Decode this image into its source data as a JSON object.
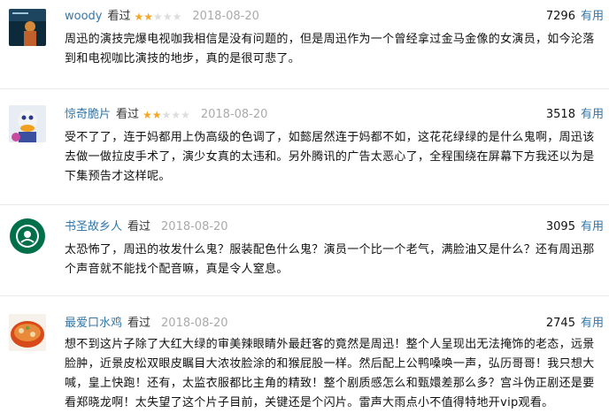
{
  "comments": [
    {
      "user": "woody",
      "status": "看过",
      "rating_stars": 2,
      "date": "2018-08-20",
      "votes": "7296",
      "useful_label": "有用",
      "text": "周迅的演技完爆电视咖我相信是没有问题的，但是周迅作为一个曾经拿过金马金像的女演员，如今沦落到和电视咖比演技的地步，真的是很可悲了。"
    },
    {
      "user": "惊奇脆片",
      "status": "看过",
      "rating_stars": 2,
      "date": "2018-08-20",
      "votes": "3518",
      "useful_label": "有用",
      "text": "受不了了，连于妈都用上伪高级的色调了，如懿居然连于妈都不如，这花花绿绿的是什么鬼啊，周迅该去做一做拉皮手术了，演少女真的太违和。另外腾讯的广告太恶心了，全程围绕在屏幕下方我还以为是下集预告才这样呢。"
    },
    {
      "user": "书圣故乡人",
      "status": "看过",
      "rating_stars": 0,
      "date": "2018-08-20",
      "votes": "3095",
      "useful_label": "有用",
      "text": "太恐怖了，周迅的妆发什么鬼？服装配色什么鬼？演员一个比一个老气，满脸油又是什么？还有周迅那个声音就不能找个配音嘛，真是令人窒息。"
    },
    {
      "user": "最爱口水鸡",
      "status": "看过",
      "rating_stars": 0,
      "date": "2018-08-20",
      "votes": "2745",
      "useful_label": "有用",
      "text": "想不到这片子除了大红大绿的审美辣眼睛外最赶客的竟然是周迅！整个人呈现出无法掩饰的老态，远景脸肿，近景皮松双眼皮瞩目大浓妆脸涂的和猴屁股一样。然后配上公鸭嗓唤一声，弘历哥哥！我只想大喊，皇上快跑！还有，太监衣服都比主角的精致！整个剧质感怎么和甄嬛差那么多？宫斗伪正剧还是要看郑晓龙啊！太失望了这个片子目前，关键还是个闪片。雷声大雨点小不值得特地开vip观看。"
    }
  ]
}
